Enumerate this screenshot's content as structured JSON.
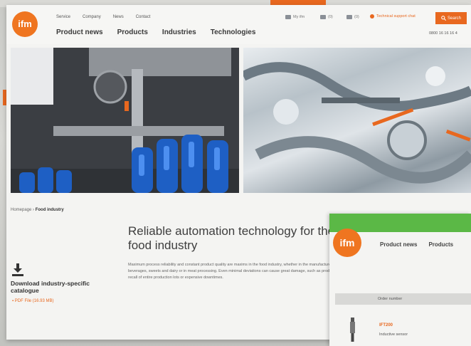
{
  "header": {
    "logo_text": "ifm",
    "topnav": [
      "Service",
      "Company",
      "News",
      "Contact"
    ],
    "mainnav": [
      "Product news",
      "Products",
      "Industries",
      "Technologies"
    ],
    "util_items": [
      "My ifm",
      "(0)",
      "(0)"
    ],
    "partner_label": "Technical support chat",
    "search_label": "Search",
    "phone": "0800 16 16 16 4"
  },
  "breadcrumb": {
    "home": "Homepage",
    "separator": " › ",
    "current": "Food industry"
  },
  "main": {
    "heading": "Reliable automation technology for the food industry",
    "body": "Maximum process reliability and constant product quality are maxims in the food industry, whether in the manufacture of beverages, sweets and dairy or in meat processing. Even minimal deviations can cause great damage, such as product recall of entire production lots or expensive downtimes."
  },
  "download": {
    "title": "Download industry-specific catalogue",
    "link": "PDF File (16.93 MB)"
  },
  "overlay": {
    "logo_text": "ifm",
    "nav": [
      "Product news",
      "Products"
    ],
    "bar_label": "Order number",
    "product_name": "IFT200",
    "product_desc": "Inductive sensor"
  },
  "colors": {
    "accent": "#e8681f",
    "green": "#5bb846"
  }
}
